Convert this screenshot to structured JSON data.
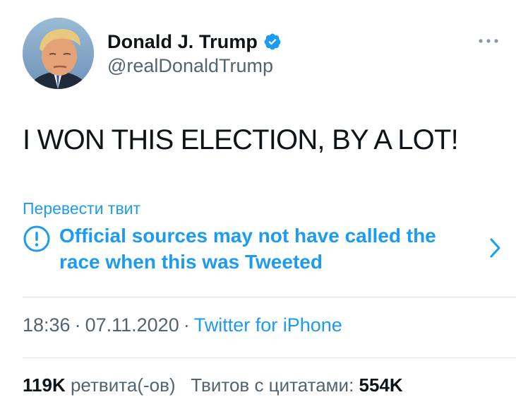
{
  "user": {
    "display_name": "Donald J. Trump",
    "handle": "@realDonaldTrump",
    "verified": true
  },
  "tweet": {
    "text": "I WON THIS ELECTION, BY A LOT!",
    "translate_link": "Перевести твит",
    "notice": "Official sources may not have called the race when this was Tweeted"
  },
  "meta": {
    "time": "18:36",
    "separator": "·",
    "date": "07.11.2020",
    "source": "Twitter for iPhone"
  },
  "stats": {
    "retweets_count": "119K",
    "retweets_label": "ретвита(-ов)",
    "quotes_label": "Твитов с цитатами:",
    "quotes_count": "554K"
  },
  "colors": {
    "accent": "#1d9bf0",
    "text": "#0f1419",
    "secondary": "#536471",
    "divider": "#dbe1e6"
  }
}
